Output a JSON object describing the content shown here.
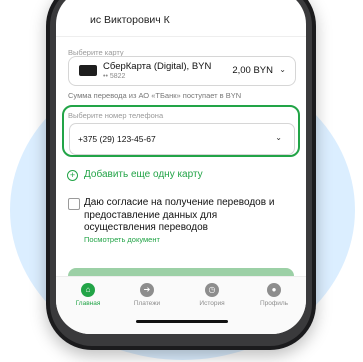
{
  "header": {
    "recipient_name": "ис Викторович К"
  },
  "card_section": {
    "label": "Выберите карту",
    "card_name": "СберКарта (Digital), BYN",
    "card_number": "•• 5822",
    "amount": "2,00 BYN"
  },
  "note": "Сумма перевода из АО «ТБанк» поступает в BYN",
  "phone_section": {
    "label": "Выберите номер телефона",
    "value": "+375 (29) 123-45-67"
  },
  "add_card": {
    "label": "Добавить еще одну карту"
  },
  "consent": {
    "text": "Даю согласие на получение переводов и предоставление данных для осуществления переводов",
    "link": "Посмотреть документ"
  },
  "tabs": [
    {
      "label": "Главная",
      "icon": "home-icon"
    },
    {
      "label": "Платежи",
      "icon": "arrow-icon"
    },
    {
      "label": "История",
      "icon": "clock-icon"
    },
    {
      "label": "Профиль",
      "icon": "profile-icon"
    }
  ],
  "colors": {
    "accent": "#22a447",
    "button": "#9cd0a6",
    "background_circle": "#dbeeff"
  }
}
